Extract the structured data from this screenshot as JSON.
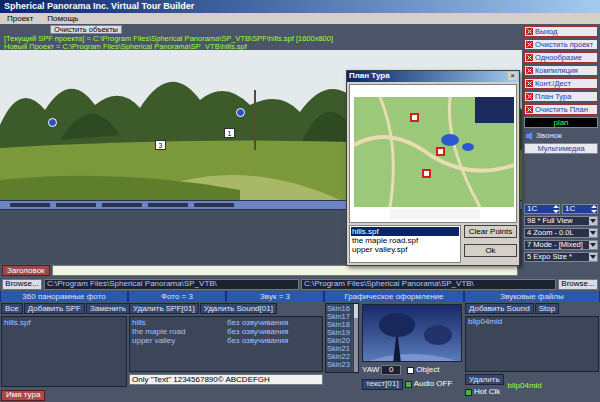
{
  "window": {
    "title": "Spherical Panorama Inc. Virtual Tour Builder"
  },
  "menu": [
    "Проект",
    "Помощь"
  ],
  "project": {
    "clear_button": "Очистить объекты",
    "current": "[Текущий SPF проекта] = C:\\Program Files\\Spherical Panorama\\SP_VTB\\SPF\\hills.spf [1600x800]",
    "new": "Новый Проект = C:\\Program Files\\Spherical Panorama\\SP_VTB\\hills.spf"
  },
  "panorama": {
    "hotspots": [
      {
        "label": "1"
      },
      {
        "label": "3"
      }
    ]
  },
  "side_buttons": [
    "Выход",
    "Очистить проект",
    "Однообразие",
    "Компиляция",
    "Конт./Дест",
    "План Тура",
    "Очистить План"
  ],
  "side_field": "plan",
  "sound_link": "Звонок",
  "multimedia_button": "Мультимедиа",
  "spinners": [
    "1C",
    "1C"
  ],
  "dropdowns": [
    "98 * Full View",
    "4 Zoom - 0.0L",
    "7 Mode - [Mixed]",
    "5 Expo Size *"
  ],
  "plan_window": {
    "title": "План Тура",
    "close": "×",
    "files": [
      {
        "name": "hills.spf",
        "selected": true
      },
      {
        "name": "the maple road.spf",
        "selected": false
      },
      {
        "name": "upper valley.spf",
        "selected": false
      }
    ],
    "buttons": [
      "Clear Points",
      "Ok"
    ]
  },
  "title_row": {
    "label": "Заголовок"
  },
  "browse": {
    "left_button": "Browse...",
    "left_path": "C:\\Program Files\\Spherical Panorama\\SP_VTB\\",
    "right_path": "C:\\Program Files\\Spherical Panorama\\SP_VTB\\",
    "right_button": "Browse..."
  },
  "headers": [
    "360 панорамные фото",
    "Фото = 3",
    "Звук = 3",
    "Графическое оформление",
    "Звуковые файлы"
  ],
  "spf_panel": {
    "buttons": [
      "Все",
      "Добавить SPF",
      "Заменить"
    ],
    "files": [
      {
        "name": "hills.spf",
        "selected": false
      }
    ],
    "tour_name_button": "Имя тура"
  },
  "scenes_panel": {
    "buttons": [
      "Удалить SPF[01]",
      "Удалить Sound[01]"
    ],
    "rows": [
      [
        "hills",
        "без озвучивания"
      ],
      [
        "the maple road",
        "без озвучивания"
      ],
      [
        "upper valley",
        "без озвучивания"
      ]
    ],
    "text_sample": "Only \"Text\" 1234567890© ABCDEFGH"
  },
  "skins": [
    "Skin16",
    "Skin17",
    "Skin18",
    "Skin19",
    "Skin20",
    "Skin21",
    "Skin22",
    "Skin23"
  ],
  "graphics_panel": {
    "yaw_label": "YAW",
    "yaw_value": "0",
    "object": {
      "label": "Object",
      "checked": false
    },
    "audio_off": {
      "label": "Audio OFF",
      "checked": true
    },
    "text_button": "текст[01]"
  },
  "sounds_panel": {
    "buttons": [
      "Добавить Sound",
      "Stop"
    ],
    "files": [
      "blip04mid"
    ],
    "delete_button": "Удалить",
    "hot_click": {
      "label": "Hot Clk",
      "checked": true
    },
    "current": "blip04mid"
  }
}
